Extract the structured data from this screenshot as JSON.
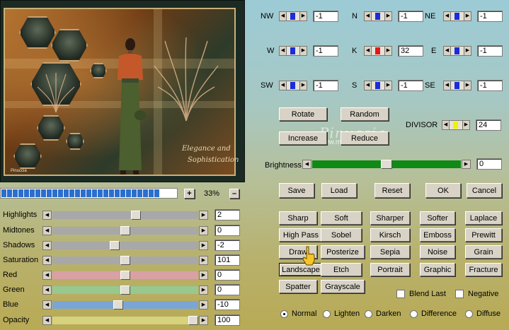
{
  "preview": {
    "signature_line1": "Elegance and",
    "signature_line2": "Sophistication",
    "brand": "Pinuccia"
  },
  "watermark": {
    "name": "Pinuccia",
    "url": "www.madregrafica.eu"
  },
  "progress": {
    "fraction": 1.0,
    "blocks": 28
  },
  "zoom": {
    "plus": "+",
    "value": "33%",
    "minus": "–"
  },
  "sliders": [
    {
      "label": "Highlights",
      "value": "2",
      "position": 0.58,
      "color": "#a8a8a8"
    },
    {
      "label": "Midtones",
      "value": "0",
      "position": 0.5,
      "color": "#a8a8a8"
    },
    {
      "label": "Shadows",
      "value": "-2",
      "position": 0.42,
      "color": "#a8a8a8"
    },
    {
      "label": "Saturation",
      "value": "101",
      "position": 0.5,
      "color": "#a8a8a8"
    },
    {
      "label": "Red",
      "value": "0",
      "position": 0.5,
      "color": "#d9a1a4"
    },
    {
      "label": "Green",
      "value": "0",
      "position": 0.5,
      "color": "#98c890"
    },
    {
      "label": "Blue",
      "value": "-10",
      "position": 0.45,
      "color": "#7aa6d6"
    },
    {
      "label": "Opacity",
      "value": "100",
      "position": 1.0,
      "color": "#d6d27e"
    }
  ],
  "kernel": [
    {
      "label": "NW",
      "value": "-1",
      "color": "#1a2dd8"
    },
    {
      "label": "N",
      "value": "-1",
      "color": "#1a2dd8"
    },
    {
      "label": "NE",
      "value": "-1",
      "color": "#1a2dd8"
    },
    {
      "label": "W",
      "value": "-1",
      "color": "#1a2dd8"
    },
    {
      "label": "K",
      "value": "32",
      "color": "#e01a1a"
    },
    {
      "label": "E",
      "value": "-1",
      "color": "#1a2dd8"
    },
    {
      "label": "SW",
      "value": "-1",
      "color": "#1a2dd8"
    },
    {
      "label": "S",
      "value": "-1",
      "color": "#1a2dd8"
    },
    {
      "label": "SE",
      "value": "-1",
      "color": "#1a2dd8"
    }
  ],
  "buttons": {
    "rotate": "Rotate",
    "random": "Random",
    "increase": "Increase",
    "reduce": "Reduce",
    "save": "Save",
    "load": "Load",
    "reset": "Reset",
    "ok": "OK",
    "cancel": "Cancel"
  },
  "divisor": {
    "label": "DIVISOR",
    "value": "24",
    "color": "#f2f200"
  },
  "brightness": {
    "label": "Brightness",
    "value": "0",
    "position": 0.5
  },
  "presets": [
    [
      "Sharp",
      "Soft",
      "Sharper",
      "Softer",
      "Laplace"
    ],
    [
      "High Pass",
      "Sobel",
      "Kirsch",
      "Emboss",
      "Prewitt"
    ],
    [
      "Draw",
      "Posterize",
      "Sepia",
      "Noise",
      "Grain"
    ],
    [
      "Landscape",
      "Etch",
      "Portrait",
      "Graphic",
      "Fracture"
    ],
    [
      "Spatter",
      "Grayscale"
    ]
  ],
  "selected_preset": "Landscape",
  "checks": {
    "blend_last": "Blend Last",
    "negative": "Negative"
  },
  "blend_modes": [
    "Normal",
    "Lighten",
    "Darken",
    "Difference",
    "Diffuse"
  ],
  "blend_selected": "Normal"
}
